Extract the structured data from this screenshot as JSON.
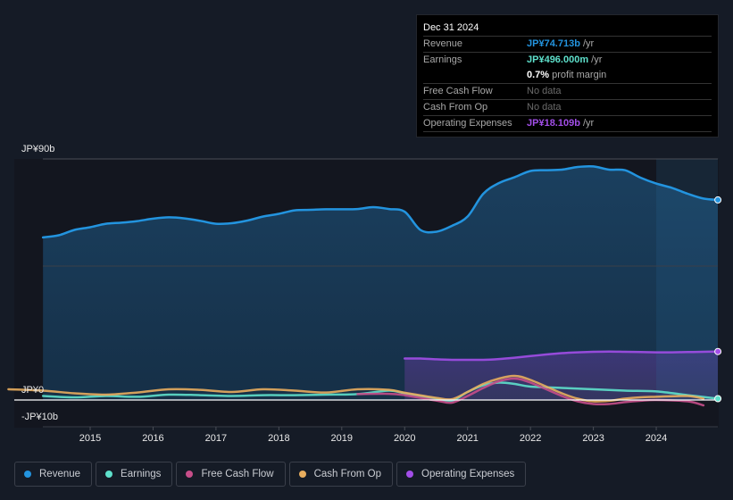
{
  "tooltip": {
    "date": "Dec 31 2024",
    "rows": [
      {
        "label": "Revenue",
        "value": "JP¥74.713b",
        "suffix": " /yr",
        "color": "#2394df"
      },
      {
        "label": "Earnings",
        "value": "JP¥496.000m",
        "suffix": " /yr",
        "color": "#5ee0cb"
      },
      {
        "label": "",
        "value": "0.7%",
        "suffix": " profit margin",
        "color": "#ffffff"
      },
      {
        "label": "Free Cash Flow",
        "value": "No data",
        "suffix": "",
        "color": "#6b6b6b"
      },
      {
        "label": "Cash From Op",
        "value": "No data",
        "suffix": "",
        "color": "#6b6b6b"
      },
      {
        "label": "Operating Expenses",
        "value": "JP¥18.109b",
        "suffix": " /yr",
        "color": "#a24ee8"
      }
    ]
  },
  "legend": [
    {
      "label": "Revenue",
      "color": "#2394df"
    },
    {
      "label": "Earnings",
      "color": "#5ee0cb"
    },
    {
      "label": "Free Cash Flow",
      "color": "#c64e89"
    },
    {
      "label": "Cash From Op",
      "color": "#e8ad5e"
    },
    {
      "label": "Operating Expenses",
      "color": "#a24ee8"
    }
  ],
  "chart_data": {
    "type": "line",
    "title": "",
    "xlabel": "",
    "ylabel": "",
    "ylim": [
      -10,
      90
    ],
    "xlim": [
      2013.7,
      2024.98
    ],
    "y_tick_labels": [
      {
        "value": 90,
        "label": "JP¥90b"
      },
      {
        "value": 0,
        "label": "JP¥0"
      },
      {
        "value": -10,
        "label": "-JP¥10b"
      }
    ],
    "x_tick_labels": [
      "2015",
      "2016",
      "2017",
      "2018",
      "2019",
      "2020",
      "2021",
      "2022",
      "2023",
      "2024"
    ],
    "x_ticks": [
      2015,
      2016,
      2017,
      2018,
      2019,
      2020,
      2021,
      2022,
      2023,
      2024
    ],
    "highlight_from": 2024.0,
    "unit": "JP¥ billions",
    "series": [
      {
        "name": "Revenue",
        "color": "#2394df",
        "x": [
          2014.25,
          2014.5,
          2014.75,
          2015.0,
          2015.25,
          2015.5,
          2015.75,
          2016.0,
          2016.25,
          2016.5,
          2016.75,
          2017.0,
          2017.25,
          2017.5,
          2017.75,
          2018.0,
          2018.25,
          2018.5,
          2018.75,
          2019.0,
          2019.25,
          2019.5,
          2019.75,
          2020.0,
          2020.25,
          2020.5,
          2020.75,
          2021.0,
          2021.25,
          2021.5,
          2021.75,
          2022.0,
          2022.25,
          2022.5,
          2022.75,
          2023.0,
          2023.25,
          2023.5,
          2023.75,
          2024.0,
          2024.25,
          2024.5,
          2024.75,
          2024.98
        ],
        "values": [
          60.7,
          61.5,
          63.5,
          64.5,
          65.8,
          66.2,
          66.8,
          67.7,
          68.2,
          67.8,
          66.9,
          65.8,
          66.0,
          67.0,
          68.5,
          69.5,
          70.8,
          71.0,
          71.2,
          71.2,
          71.3,
          72.0,
          71.3,
          70.3,
          63.5,
          62.8,
          65.0,
          68.5,
          77.0,
          81.0,
          83.2,
          85.5,
          85.8,
          86.0,
          87.0,
          87.2,
          86.0,
          85.8,
          83.0,
          80.8,
          79.2,
          77.0,
          75.2,
          74.7
        ]
      },
      {
        "name": "Earnings",
        "color": "#5ee0cb",
        "x": [
          2014.25,
          2014.75,
          2015.25,
          2015.75,
          2016.25,
          2016.75,
          2017.25,
          2017.75,
          2018.25,
          2018.75,
          2019.25,
          2019.75,
          2020.0,
          2020.5,
          2020.75,
          2021.0,
          2021.25,
          2021.5,
          2021.75,
          2022.0,
          2022.5,
          2023.0,
          2023.5,
          2024.0,
          2024.5,
          2024.98
        ],
        "values": [
          1.5,
          1.0,
          1.5,
          1.2,
          2.0,
          1.8,
          1.5,
          1.8,
          1.8,
          2.0,
          2.2,
          3.5,
          2.5,
          0.5,
          -0.3,
          3.0,
          5.5,
          6.5,
          6.0,
          5.0,
          4.5,
          4.0,
          3.5,
          3.2,
          1.8,
          0.5
        ]
      },
      {
        "name": "Free Cash Flow",
        "color": "#c64e89",
        "x": [
          2019.25,
          2019.75,
          2020.0,
          2020.5,
          2020.75,
          2021.0,
          2021.25,
          2021.5,
          2021.75,
          2022.0,
          2022.5,
          2022.75,
          2023.0,
          2023.25,
          2023.5,
          2023.75,
          2024.0,
          2024.5,
          2024.75
        ],
        "values": [
          2.2,
          2.3,
          1.8,
          -0.2,
          -1.0,
          1.5,
          4.5,
          7.0,
          8.0,
          6.5,
          1.5,
          -0.5,
          -1.5,
          -1.5,
          -0.8,
          -0.3,
          0.0,
          -0.5,
          -2.0
        ]
      },
      {
        "name": "Cash From Op",
        "color": "#e8ad5e",
        "x": [
          2013.7,
          2014.25,
          2014.75,
          2015.25,
          2015.75,
          2016.25,
          2016.75,
          2017.25,
          2017.75,
          2018.25,
          2018.75,
          2019.25,
          2019.75,
          2020.0,
          2020.5,
          2020.75,
          2021.0,
          2021.25,
          2021.5,
          2021.75,
          2022.0,
          2022.5,
          2022.75,
          2023.0,
          2023.25,
          2023.5,
          2023.75,
          2024.0,
          2024.5,
          2024.75
        ],
        "values": [
          4.0,
          3.5,
          2.5,
          2.0,
          2.8,
          4.0,
          3.8,
          3.0,
          4.0,
          3.5,
          2.8,
          4.0,
          3.8,
          2.7,
          0.8,
          0.3,
          3.0,
          6.0,
          8.0,
          9.0,
          7.5,
          2.5,
          0.5,
          -0.5,
          -0.3,
          0.5,
          1.0,
          1.2,
          1.5,
          0.5
        ]
      },
      {
        "name": "Operating Expenses",
        "color": "#a24ee8",
        "x": [
          2020.0,
          2020.25,
          2020.5,
          2020.75,
          2021.0,
          2021.25,
          2021.5,
          2021.75,
          2022.0,
          2022.25,
          2022.5,
          2022.75,
          2023.0,
          2023.25,
          2023.5,
          2023.75,
          2024.0,
          2024.25,
          2024.5,
          2024.75,
          2024.98
        ],
        "values": [
          15.5,
          15.5,
          15.2,
          15.0,
          15.0,
          15.0,
          15.3,
          15.8,
          16.4,
          17.0,
          17.5,
          17.8,
          18.0,
          18.1,
          18.0,
          17.9,
          17.8,
          17.8,
          17.9,
          18.0,
          18.1
        ]
      }
    ]
  }
}
